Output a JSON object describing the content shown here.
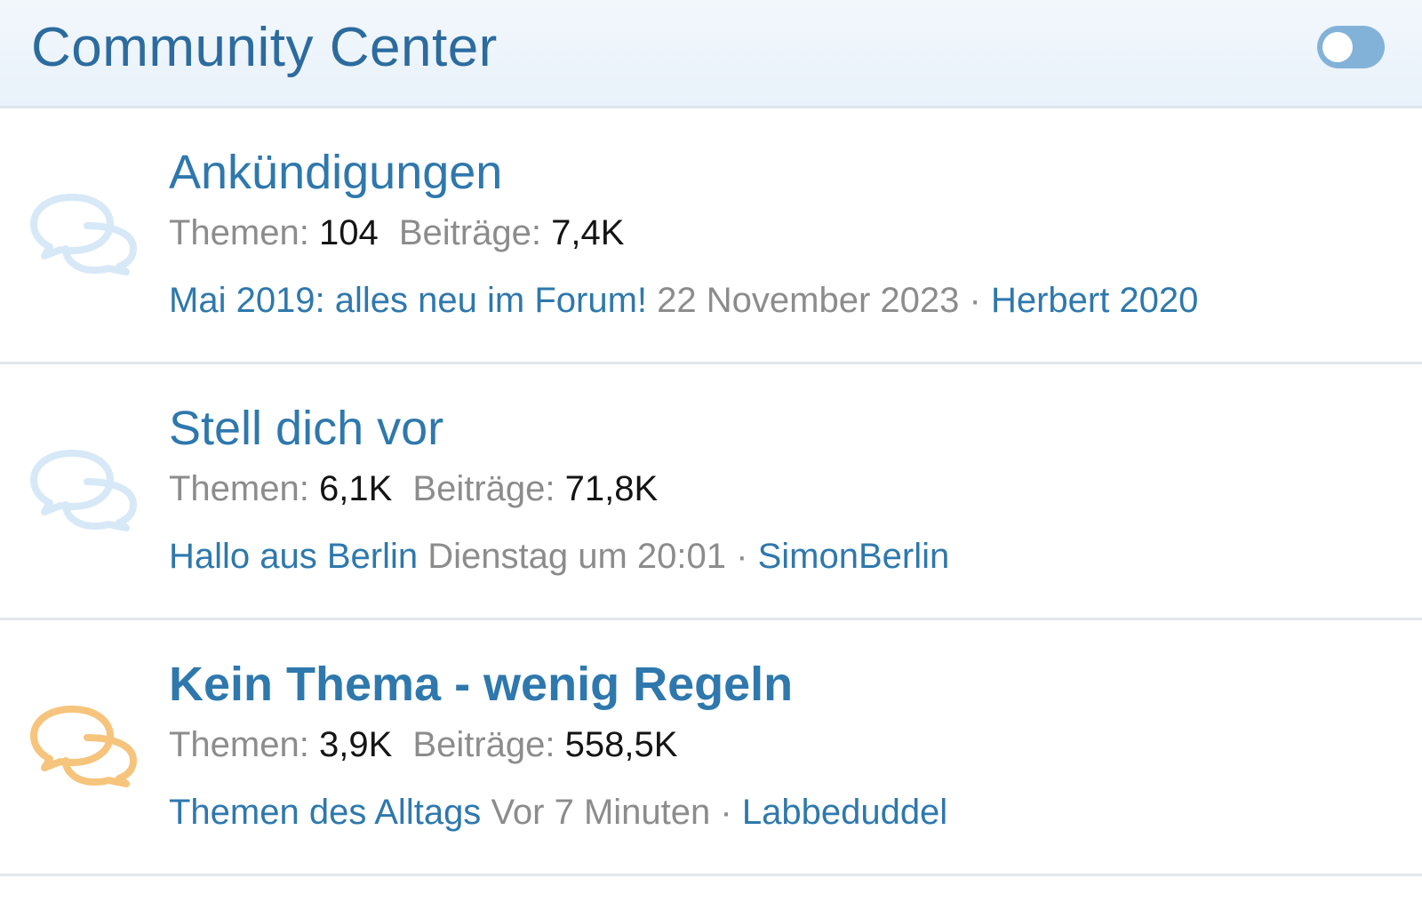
{
  "header": {
    "title": "Community Center",
    "toggle_icon": "collapse-toggle"
  },
  "colors": {
    "accent": "#2e78ad",
    "header_bg": "#edf4fb",
    "icon_read": "#d7e8f7",
    "icon_unread": "#f6c47c",
    "muted_text": "#8c8c8c"
  },
  "forums": [
    {
      "icon": "chat-bubbles-icon",
      "title": "Ankündigungen",
      "themen_label": "Themen:",
      "themen_value": "104",
      "beitraege_label": "Beiträge:",
      "beitraege_value": "7,4K",
      "latest_title": "Mai 2019: alles neu im Forum!",
      "latest_date": "22 November 2023",
      "separator": "·",
      "latest_user": "Herbert 2020"
    },
    {
      "icon": "chat-bubbles-icon",
      "title": "Stell dich vor",
      "themen_label": "Themen:",
      "themen_value": "6,1K",
      "beitraege_label": "Beiträge:",
      "beitraege_value": "71,8K",
      "latest_title": "Hallo aus Berlin",
      "latest_date": "Dienstag um 20:01",
      "separator": "·",
      "latest_user": "SimonBerlin"
    },
    {
      "icon": "chat-bubbles-icon",
      "title": "Kein Thema - wenig Regeln",
      "themen_label": "Themen:",
      "themen_value": "3,9K",
      "beitraege_label": "Beiträge:",
      "beitraege_value": "558,5K",
      "latest_title": "Themen des Alltags",
      "latest_date": "Vor 7 Minuten",
      "separator": "·",
      "latest_user": "Labbeduddel"
    }
  ]
}
